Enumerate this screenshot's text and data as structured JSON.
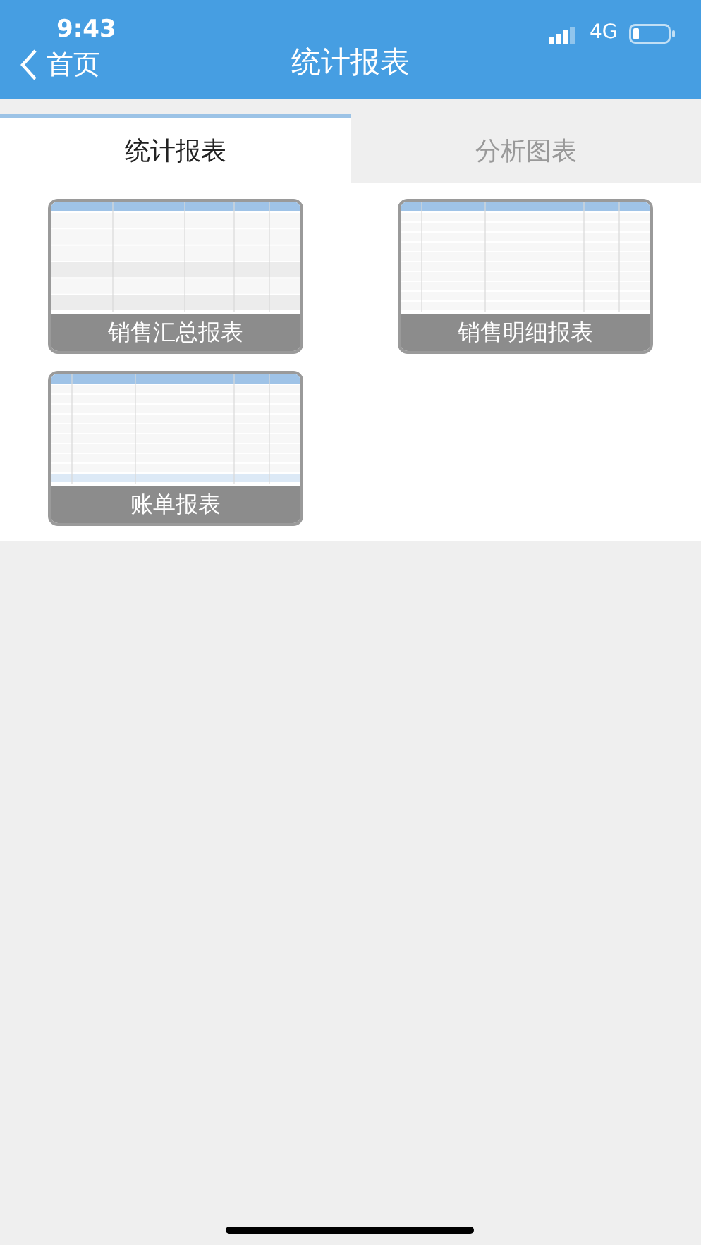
{
  "status_bar": {
    "time": "9:43",
    "network": "4G"
  },
  "nav_bar": {
    "back_label": "首页",
    "title": "统计报表"
  },
  "tabs": [
    {
      "label": "统计报表",
      "selected": true
    },
    {
      "label": "分析图表",
      "selected": false
    }
  ],
  "reports": [
    {
      "title": "销售汇总报表",
      "kind": "picture"
    },
    {
      "title": "销售明细报表",
      "kind": "picture"
    },
    {
      "title": "账单报表",
      "kind": "picture"
    }
  ]
}
